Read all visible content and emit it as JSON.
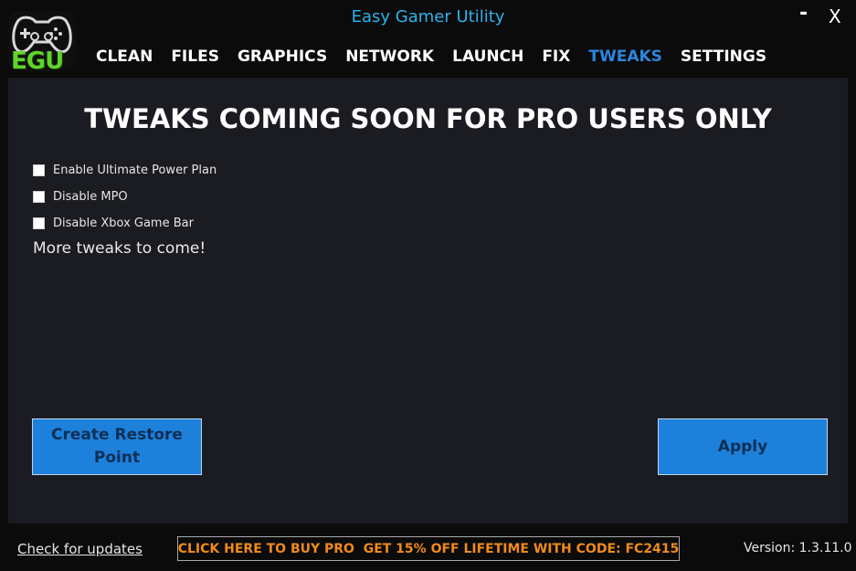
{
  "app": {
    "title": "Easy Gamer Utility",
    "logo_text": "EGU",
    "minimize_label": "-",
    "close_label": "X"
  },
  "nav": {
    "tabs": [
      {
        "label": "CLEAN",
        "active": false
      },
      {
        "label": "FILES",
        "active": false
      },
      {
        "label": "GRAPHICS",
        "active": false
      },
      {
        "label": "NETWORK",
        "active": false
      },
      {
        "label": "LAUNCH",
        "active": false
      },
      {
        "label": "FIX",
        "active": false
      },
      {
        "label": "TWEAKS",
        "active": true
      },
      {
        "label": "SETTINGS",
        "active": false
      }
    ]
  },
  "tweaks": {
    "heading": "TWEAKS COMING SOON FOR PRO USERS ONLY",
    "options": [
      {
        "label": "Enable Ultimate Power Plan",
        "checked": false
      },
      {
        "label": "Disable MPO",
        "checked": false
      },
      {
        "label": "Disable Xbox Game Bar",
        "checked": false
      }
    ],
    "more_text": "More tweaks to come!",
    "restore_button": "Create Restore Point",
    "apply_button": "Apply"
  },
  "footer": {
    "check_updates": "Check for updates",
    "promo": "CLICK HERE TO BUY PRO  GET 15% OFF LIFETIME WITH CODE: FC2415",
    "version": "Version: 1.3.11.0"
  },
  "colors": {
    "accent": "#2a86e0",
    "title": "#2fb1e8",
    "promo": "#f08a1c",
    "button": "#1d81dc",
    "logo": "#5fd42a",
    "panel": "#1b1c21"
  },
  "icons": {
    "logo": "gamepad-icon"
  }
}
